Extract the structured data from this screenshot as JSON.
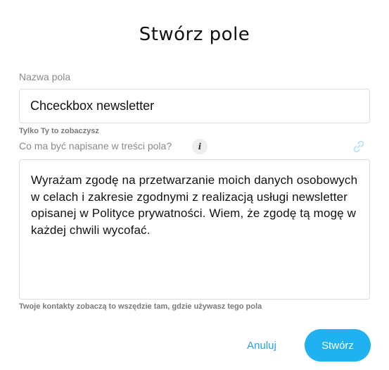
{
  "dialog": {
    "title": "Stwórz pole"
  },
  "field_name": {
    "label": "Nazwa pola",
    "value": "Chceckbox newsletter",
    "hint": "Tylko Ty to zobaczysz"
  },
  "field_content": {
    "label": "Co ma być napisane w treści pola?",
    "info_icon": "i",
    "value": "Wyrażam zgodę na przetwarzanie moich danych osobowych w celach i zakresie zgodnymi z realizacją usługi newsletter opisanej w Polityce prywatności. Wiem, że zgodę tą mogę w każdej chwili wycofać.",
    "hint": "Twoje kontakty zobaczą to wszędzie tam, gdzie używasz tego pola"
  },
  "actions": {
    "cancel_label": "Anuluj",
    "create_label": "Stwórz"
  },
  "colors": {
    "accent": "#1fb1f0",
    "link": "#1fa3e8"
  }
}
